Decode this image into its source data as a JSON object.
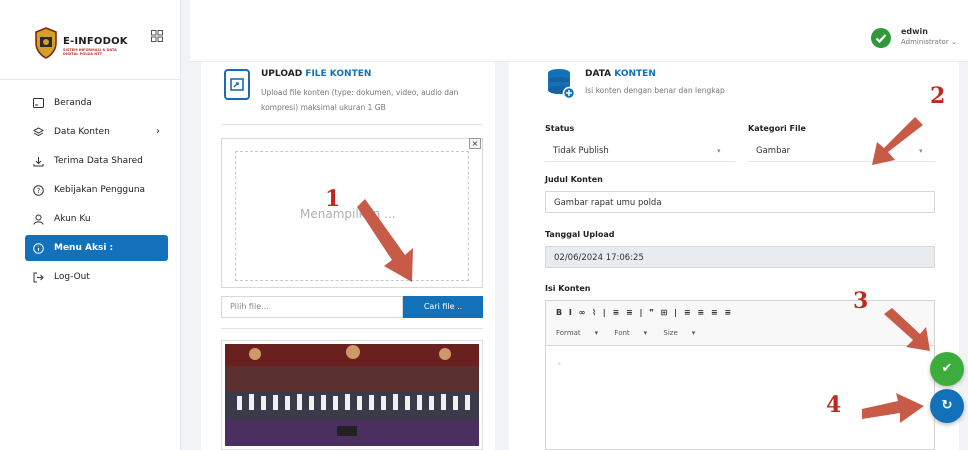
{
  "app": {
    "logo_title": "E-INFODOK",
    "logo_subtitle": "SISTEM INFORMASI & DATA DIGITAL POLDA NTT"
  },
  "sidebar": {
    "items": [
      {
        "label": "Beranda",
        "icon": "home-icon"
      },
      {
        "label": "Data Konten",
        "icon": "layers-icon",
        "chevron": "›"
      },
      {
        "label": "Terima Data Shared",
        "icon": "download-icon"
      },
      {
        "label": "Kebijakan Pengguna",
        "icon": "help-icon"
      },
      {
        "label": "Akun Ku",
        "icon": "user-icon"
      },
      {
        "label": "Menu Aksi :",
        "icon": "info-icon",
        "active": true
      },
      {
        "label": "Log-Out",
        "icon": "logout-icon"
      }
    ]
  },
  "user": {
    "name": "edwin",
    "role": "Administrator ⌄"
  },
  "upload": {
    "title_plain": "UPLOAD ",
    "title_highlight": "FILE KONTEN",
    "description": "Upload file konten (type: dokumen, video, audio dan kompresi) maksimal ukuran 1 GB",
    "dropzone_text": "Menampilkan ...",
    "close_glyph": "×",
    "file_placeholder": "Pilih file...",
    "browse_label": "Cari file .."
  },
  "data": {
    "title_plain": "DATA ",
    "title_highlight": "KONTEN",
    "description": "Isi konten dengan benar dan lengkap",
    "status_label": "Status",
    "status_value": "Tidak Publish",
    "category_label": "Kategori File",
    "category_value": "Gambar",
    "judul_label": "Judul Konten",
    "judul_value": "Gambar rapat umu polda",
    "tanggal_label": "Tanggal Upload",
    "tanggal_value": "02/06/2024 17:06:25",
    "isi_label": "Isi Konten",
    "editor_toolbar_row1": "B I ∞ ⌇ | ≡ ≡ | ❞ ⊞ | ≡ ≡ ≡ ≡",
    "editor_format": "Format",
    "editor_font": "Font",
    "editor_size": "Size",
    "editor_body": "-"
  },
  "actions": {
    "save_glyph": "✔",
    "reset_glyph": "↻"
  },
  "annotations": [
    "1",
    "2",
    "3",
    "4"
  ],
  "colors": {
    "primary": "#1271b8",
    "success": "#3cad3c",
    "annotation": "#c0281f"
  }
}
